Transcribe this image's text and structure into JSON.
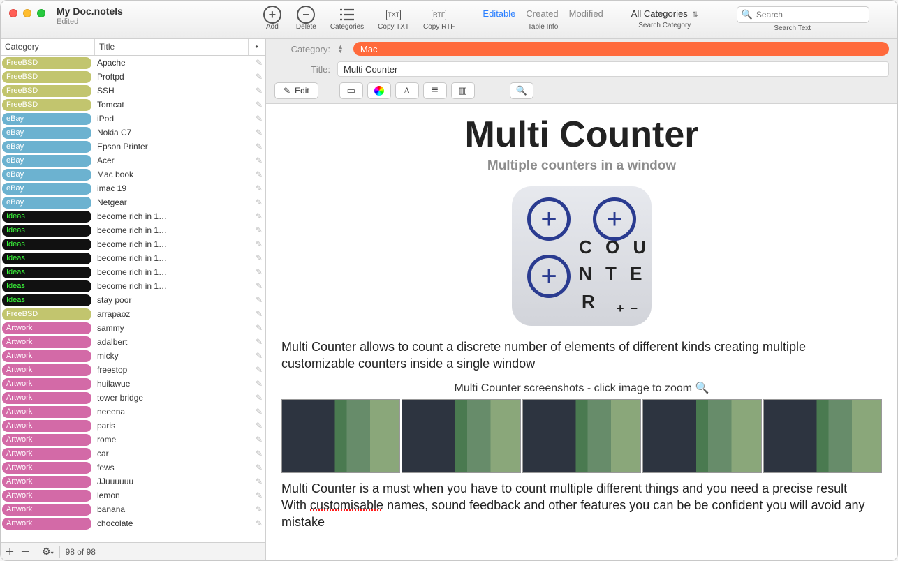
{
  "window": {
    "title": "My Doc.notels",
    "subtitle": "Edited"
  },
  "toolbar": {
    "add": "Add",
    "delete": "Delete",
    "categories": "Categories",
    "copy_txt": "Copy TXT",
    "copy_rtf": "Copy RTF",
    "tabs": {
      "editable": "Editable",
      "created": "Created",
      "modified": "Modified",
      "caption": "Table Info"
    },
    "cat_selector": {
      "label": "All Categories",
      "caption": "Search Category"
    },
    "search": {
      "placeholder": "Search",
      "caption": "Search Text"
    }
  },
  "list_header": {
    "category": "Category",
    "title": "Title",
    "dot": "•"
  },
  "rows": [
    {
      "cat": "FreeBSD",
      "cls": "c-freebsd",
      "title": "Apache"
    },
    {
      "cat": "FreeBSD",
      "cls": "c-freebsd",
      "title": "Proftpd"
    },
    {
      "cat": "FreeBSD",
      "cls": "c-freebsd",
      "title": "SSH"
    },
    {
      "cat": "FreeBSD",
      "cls": "c-freebsd",
      "title": "Tomcat"
    },
    {
      "cat": "eBay",
      "cls": "c-ebay",
      "title": "iPod"
    },
    {
      "cat": "eBay",
      "cls": "c-ebay",
      "title": "Nokia C7"
    },
    {
      "cat": "eBay",
      "cls": "c-ebay",
      "title": "Epson Printer"
    },
    {
      "cat": "eBay",
      "cls": "c-ebay",
      "title": "Acer"
    },
    {
      "cat": "eBay",
      "cls": "c-ebay",
      "title": "Mac book"
    },
    {
      "cat": "eBay",
      "cls": "c-ebay",
      "title": "imac 19"
    },
    {
      "cat": "eBay",
      "cls": "c-ebay",
      "title": "Netgear"
    },
    {
      "cat": "Ideas",
      "cls": "c-ideas",
      "title": "become rich in 1…"
    },
    {
      "cat": "Ideas",
      "cls": "c-ideas",
      "title": "become rich in 1…"
    },
    {
      "cat": "Ideas",
      "cls": "c-ideas",
      "title": "become rich in 1…"
    },
    {
      "cat": "Ideas",
      "cls": "c-ideas",
      "title": "become rich in 1…"
    },
    {
      "cat": "Ideas",
      "cls": "c-ideas",
      "title": "become rich in 1…"
    },
    {
      "cat": "Ideas",
      "cls": "c-ideas",
      "title": "become rich in 1…"
    },
    {
      "cat": "Ideas",
      "cls": "c-ideas",
      "title": "stay poor"
    },
    {
      "cat": "FreeBSD",
      "cls": "c-freebsd",
      "title": "arrapaoz"
    },
    {
      "cat": "Artwork",
      "cls": "c-artwork",
      "title": "sammy"
    },
    {
      "cat": "Artwork",
      "cls": "c-artwork",
      "title": "adalbert"
    },
    {
      "cat": "Artwork",
      "cls": "c-artwork",
      "title": "micky"
    },
    {
      "cat": "Artwork",
      "cls": "c-artwork",
      "title": "freestop"
    },
    {
      "cat": "Artwork",
      "cls": "c-artwork",
      "title": "huilawue"
    },
    {
      "cat": "Artwork",
      "cls": "c-artwork",
      "title": "tower bridge"
    },
    {
      "cat": "Artwork",
      "cls": "c-artwork",
      "title": "neeena"
    },
    {
      "cat": "Artwork",
      "cls": "c-artwork",
      "title": "paris"
    },
    {
      "cat": "Artwork",
      "cls": "c-artwork",
      "title": "rome"
    },
    {
      "cat": "Artwork",
      "cls": "c-artwork",
      "title": "car"
    },
    {
      "cat": "Artwork",
      "cls": "c-artwork",
      "title": "fews"
    },
    {
      "cat": "Artwork",
      "cls": "c-artwork",
      "title": "JJuuuuuu"
    },
    {
      "cat": "Artwork",
      "cls": "c-artwork",
      "title": "lemon"
    },
    {
      "cat": "Artwork",
      "cls": "c-artwork",
      "title": "banana"
    },
    {
      "cat": "Artwork",
      "cls": "c-artwork",
      "title": "chocolate"
    }
  ],
  "footer": {
    "count": "98 of 98"
  },
  "detail": {
    "category_label": "Category:",
    "category_value": "Mac",
    "title_label": "Title:",
    "title_value": "Multi Counter",
    "edit_btn": "Edit"
  },
  "doc": {
    "h1": "Multi Counter",
    "h3": "Multiple counters in a window",
    "p1": "Multi Counter allows to count a discrete number of elements of different kinds creating multiple customizable counters inside a single window",
    "caption": "Multi Counter screenshots - click image to zoom",
    "p2a": "Multi Counter is a must when you have to count multiple different things and you need a precise result",
    "p2b_pre": "With ",
    "p2b_und": "customisable",
    "p2b_post": " names, sound feedback and other features you can be be confident you will avoid any mistake",
    "icon_letters": {
      "l1": "C O U",
      "l2": "N T E",
      "l3": "R",
      "pm": "+ −"
    }
  }
}
